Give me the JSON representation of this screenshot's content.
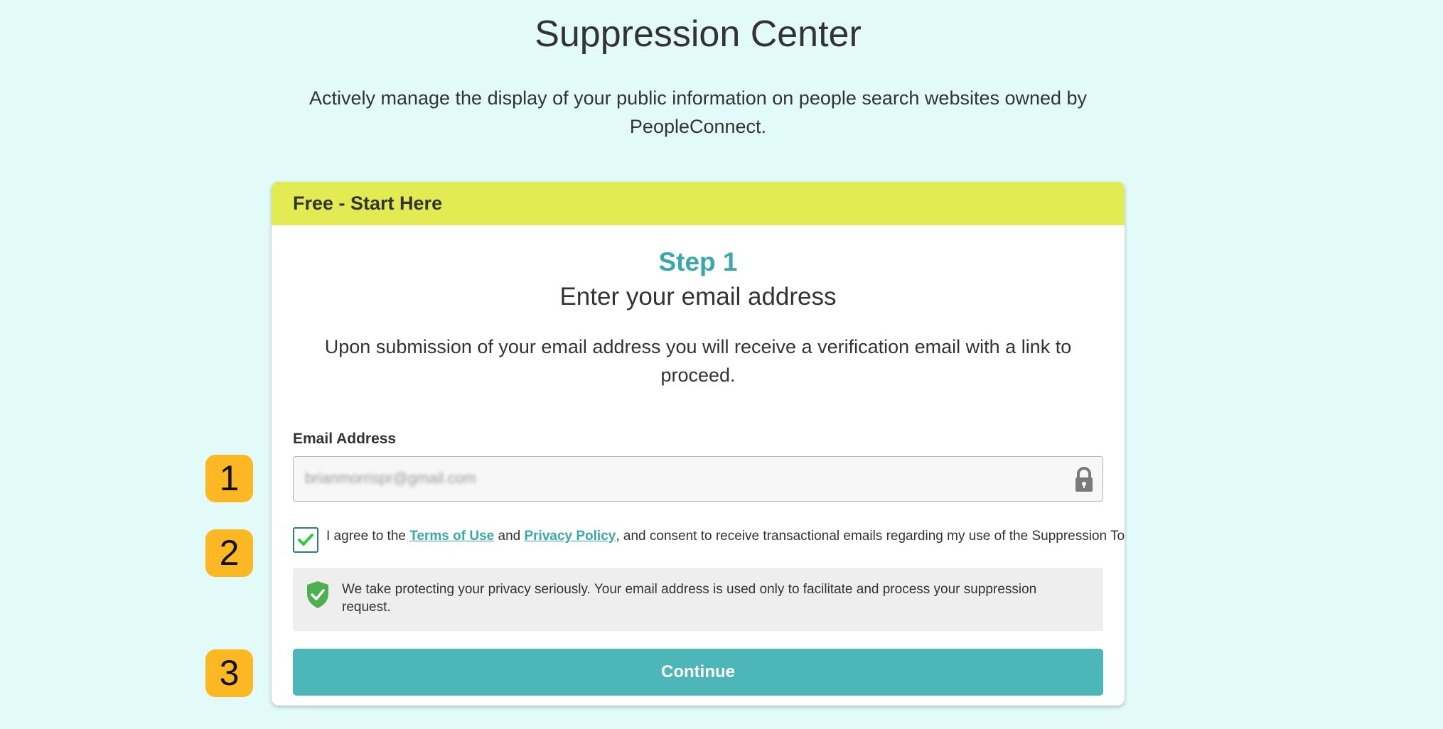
{
  "page": {
    "title": "Suppression Center",
    "subtitle": "Actively manage the display of your public information on people search websites owned by PeopleConnect."
  },
  "card": {
    "header": "Free - Start Here",
    "step_label": "Step 1",
    "step_title": "Enter your email address",
    "description": "Upon submission of your email address you will receive a verification email with a link to proceed."
  },
  "form": {
    "email_label": "Email Address",
    "email_value": "brianmorrispr@gmail.com",
    "consent": {
      "checked": true,
      "prefix": "I agree to the ",
      "terms_link": "Terms of Use",
      "middle": " and ",
      "privacy_link": "Privacy Policy",
      "suffix": ", and consent to receive transactional emails regarding my use of the Suppression Tool."
    },
    "privacy_note": "We take protecting your privacy seriously. Your email address is used only to facilitate and process your suppression request.",
    "continue_label": "Continue"
  },
  "annotations": {
    "badge_1": "1",
    "badge_2": "2",
    "badge_3": "3"
  },
  "colors": {
    "background": "#e2fbf9",
    "header": "#e2ec52",
    "accent": "#39a8ab",
    "button": "#4db6b8",
    "badge": "#fcb823",
    "shield": "#4caf50"
  }
}
